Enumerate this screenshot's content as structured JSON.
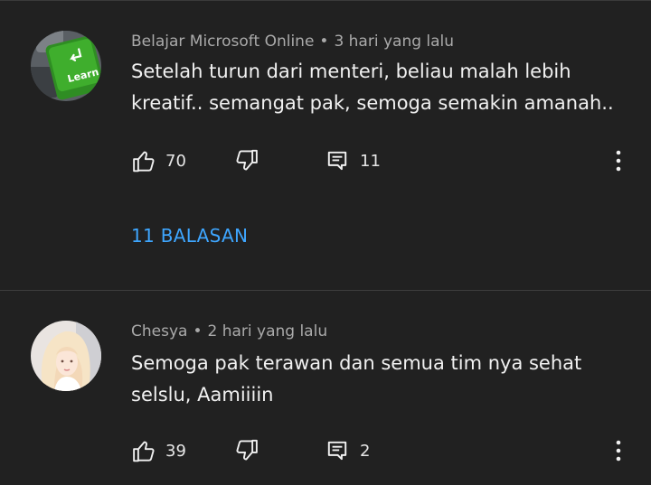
{
  "comments": [
    {
      "author": "Belajar Microsoft Online",
      "time": "3 hari yang lalu",
      "text": "Setelah turun dari menteri, beliau malah lebih kreatif.. semangat pak, semoga semakin amanah..",
      "likes": "70",
      "replies_count": "11",
      "replies_link": "11 BALASAN",
      "avatar_key_label": "Learn",
      "avatar_icon": "green-learn-key"
    },
    {
      "author": "Chesya",
      "time": "2 hari yang lalu",
      "text": "Semoga pak terawan dan semua tim nya sehat selslu,  Aamiiiin",
      "likes": "39",
      "replies_count": "2",
      "avatar_icon": "person-photo"
    }
  ],
  "colors": {
    "background": "#212121",
    "link": "#3ea6ff",
    "meta": "#aaaaaa"
  },
  "icons": [
    "thumb-up-icon",
    "thumb-down-icon",
    "reply-icon",
    "more-vertical-icon"
  ]
}
